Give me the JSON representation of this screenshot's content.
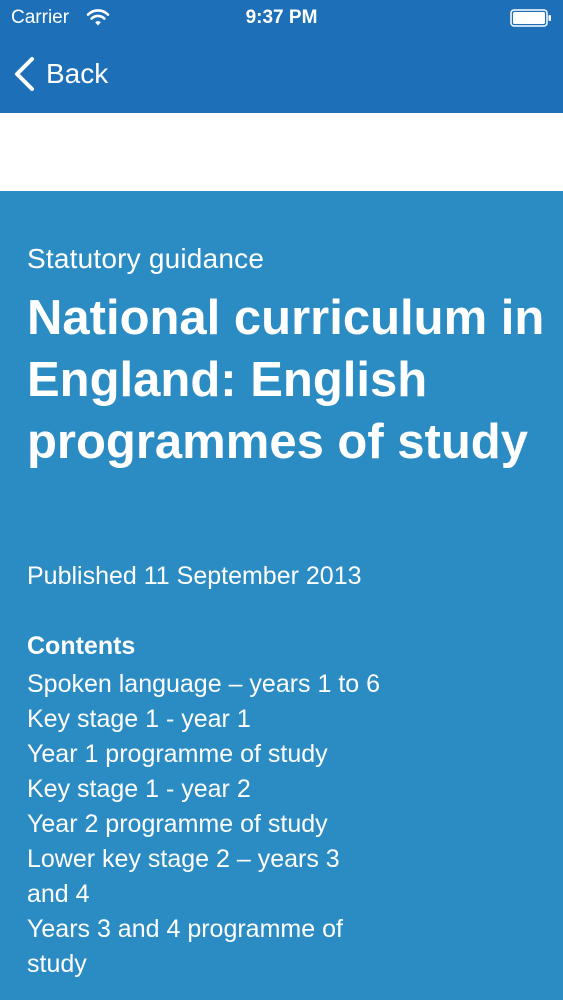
{
  "status_bar": {
    "carrier": "Carrier",
    "time": "9:37 PM"
  },
  "nav": {
    "back_label": "Back"
  },
  "document": {
    "type": "Statutory guidance",
    "title": "National curriculum in England: English programmes of study",
    "published": "Published 11 September 2013"
  },
  "contents": {
    "heading": "Contents",
    "items": [
      "Spoken language – years 1 to 6",
      "Key stage 1 - year 1",
      "Year 1 programme of study",
      "Key stage 1 - year 2",
      "Year 2 programme of study",
      "Lower key stage 2 – years 3 and 4",
      "Years 3 and 4 programme of study"
    ]
  },
  "colors": {
    "nav_background": "#1d70b8",
    "content_background": "#2b8cc4",
    "text": "#ffffff"
  }
}
